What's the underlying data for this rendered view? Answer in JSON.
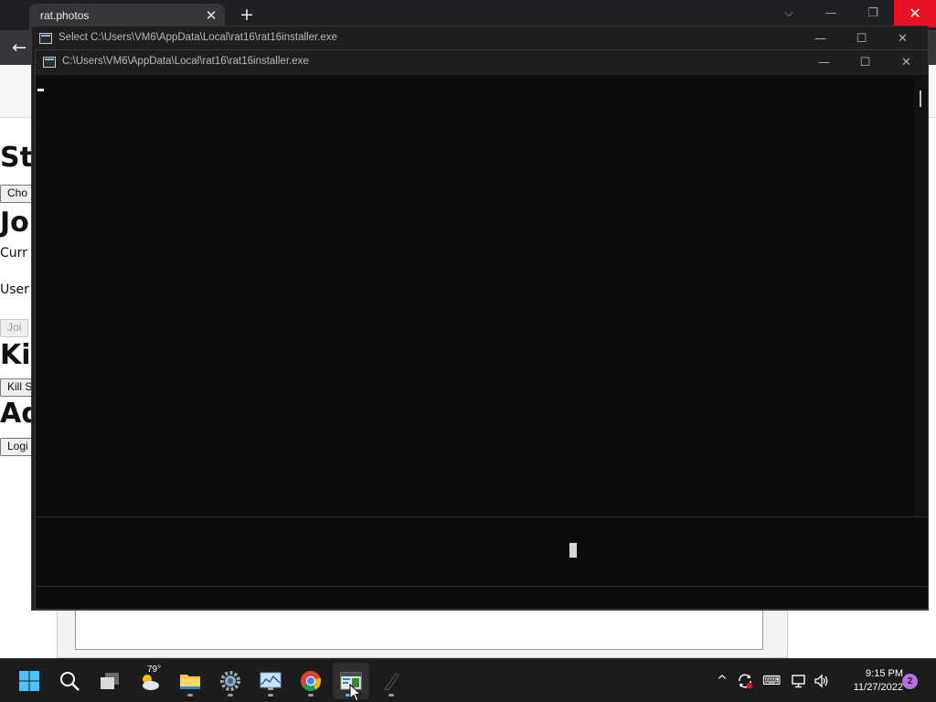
{
  "browser": {
    "tab_title": "rat.photos",
    "tab_close": "✕",
    "new_tab": "+",
    "back": "←",
    "controls": {
      "dropdown": "⌵",
      "minimize": "—",
      "restore": "❐",
      "close": "✕"
    }
  },
  "webpage": {
    "heading_1": "St",
    "button_1": "Cho",
    "heading_2": "Jo",
    "label_current": "Curr",
    "label_user": "User",
    "button_join": "Joi",
    "heading_3": "Kil",
    "button_kill": "Kill S",
    "heading_4": "Ad",
    "button_login": "Logi"
  },
  "console_back": {
    "title": "Select C:\\Users\\VM6\\AppData\\Local\\rat16\\rat16installer.exe",
    "minimize": "—",
    "maximize": "☐",
    "close": "✕"
  },
  "console_front": {
    "title": "C:\\Users\\VM6\\AppData\\Local\\rat16\\rat16installer.exe",
    "minimize": "—",
    "maximize": "☐",
    "close": "✕"
  },
  "taskbar": {
    "weather_temp": "79°",
    "apps": [
      {
        "name": "start-icon"
      },
      {
        "name": "search-icon"
      },
      {
        "name": "task-view-icon"
      },
      {
        "name": "weather-icon"
      },
      {
        "name": "file-explorer-icon"
      },
      {
        "name": "settings-icon"
      },
      {
        "name": "photos-icon"
      },
      {
        "name": "chrome-icon"
      },
      {
        "name": "terminal-icon"
      },
      {
        "name": "pen-app-icon"
      }
    ],
    "tray": {
      "chevron": "^",
      "keyboard": "⌨",
      "speaker": "🔊"
    },
    "time": "9:15 PM",
    "date": "11/27/2022",
    "notification_count": "2"
  },
  "colors": {
    "accent": "#4cc2ff",
    "close_red": "#e81123",
    "console_bg": "#0c0c0c",
    "titlebar_bg": "#1f1f1f"
  }
}
